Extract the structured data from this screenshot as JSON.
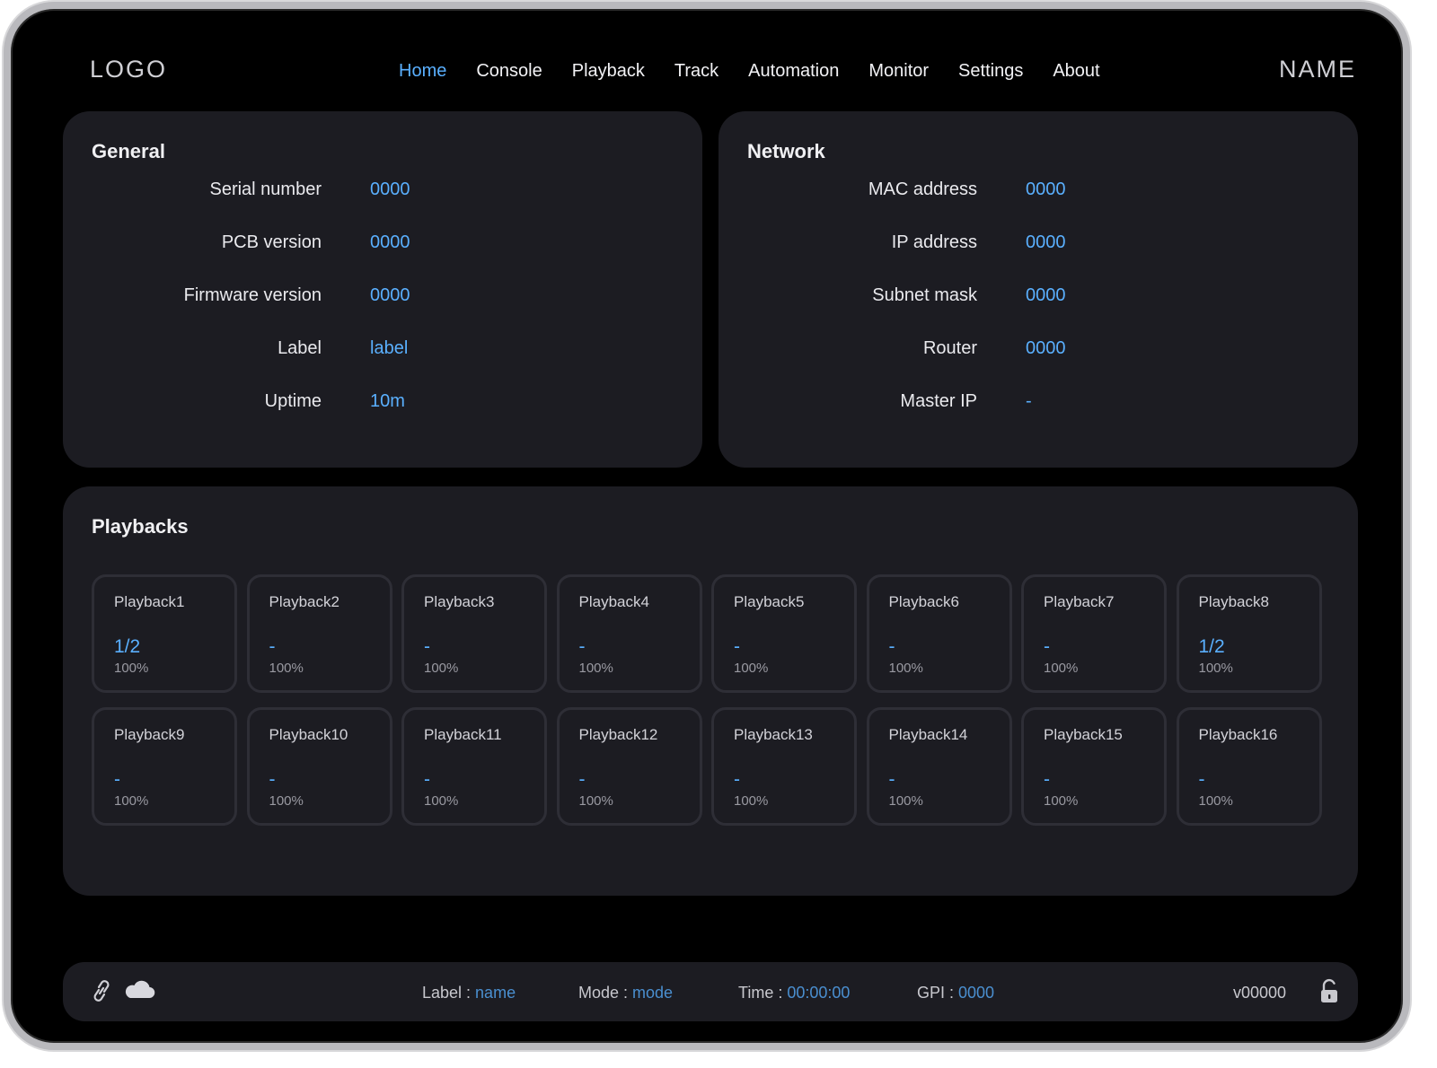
{
  "header": {
    "logo": "LOGO",
    "name": "NAME",
    "nav": [
      "Home",
      "Console",
      "Playback",
      "Track",
      "Automation",
      "Monitor",
      "Settings",
      "About"
    ],
    "active_nav": "Home"
  },
  "general": {
    "title": "General",
    "fields": [
      {
        "label": "Serial number",
        "value": "0000"
      },
      {
        "label": "PCB version",
        "value": "0000"
      },
      {
        "label": "Firmware version",
        "value": "0000"
      },
      {
        "label": "Label",
        "value": "label"
      },
      {
        "label": "Uptime",
        "value": "10m"
      }
    ]
  },
  "network": {
    "title": "Network",
    "fields": [
      {
        "label": "MAC address",
        "value": "0000"
      },
      {
        "label": "IP address",
        "value": "0000"
      },
      {
        "label": "Subnet mask",
        "value": "0000"
      },
      {
        "label": "Router",
        "value": "0000"
      },
      {
        "label": "Master IP",
        "value": "-"
      }
    ]
  },
  "playbacks": {
    "title": "Playbacks",
    "items": [
      {
        "name": "Playback1",
        "state": "1/2",
        "level": "100%"
      },
      {
        "name": "Playback2",
        "state": "-",
        "level": "100%"
      },
      {
        "name": "Playback3",
        "state": "-",
        "level": "100%"
      },
      {
        "name": "Playback4",
        "state": "-",
        "level": "100%"
      },
      {
        "name": "Playback5",
        "state": "-",
        "level": "100%"
      },
      {
        "name": "Playback6",
        "state": "-",
        "level": "100%"
      },
      {
        "name": "Playback7",
        "state": "-",
        "level": "100%"
      },
      {
        "name": "Playback8",
        "state": "1/2",
        "level": "100%"
      },
      {
        "name": "Playback9",
        "state": "-",
        "level": "100%"
      },
      {
        "name": "Playback10",
        "state": "-",
        "level": "100%"
      },
      {
        "name": "Playback11",
        "state": "-",
        "level": "100%"
      },
      {
        "name": "Playback12",
        "state": "-",
        "level": "100%"
      },
      {
        "name": "Playback13",
        "state": "-",
        "level": "100%"
      },
      {
        "name": "Playback14",
        "state": "-",
        "level": "100%"
      },
      {
        "name": "Playback15",
        "state": "-",
        "level": "100%"
      },
      {
        "name": "Playback16",
        "state": "-",
        "level": "100%"
      }
    ]
  },
  "status": {
    "label_key": "Label : ",
    "label_value": "name",
    "mode_key": "Mode : ",
    "mode_value": "mode",
    "time_key": "Time : ",
    "time_value": "00:00:00",
    "gpi_key": "GPI : ",
    "gpi_value": "0000",
    "version": "v00000",
    "icons": [
      "link-icon",
      "cloud-icon",
      "unlock-icon"
    ]
  },
  "colors": {
    "accent": "#5ab0ff",
    "panel": "#1c1c22",
    "background": "#000000"
  }
}
